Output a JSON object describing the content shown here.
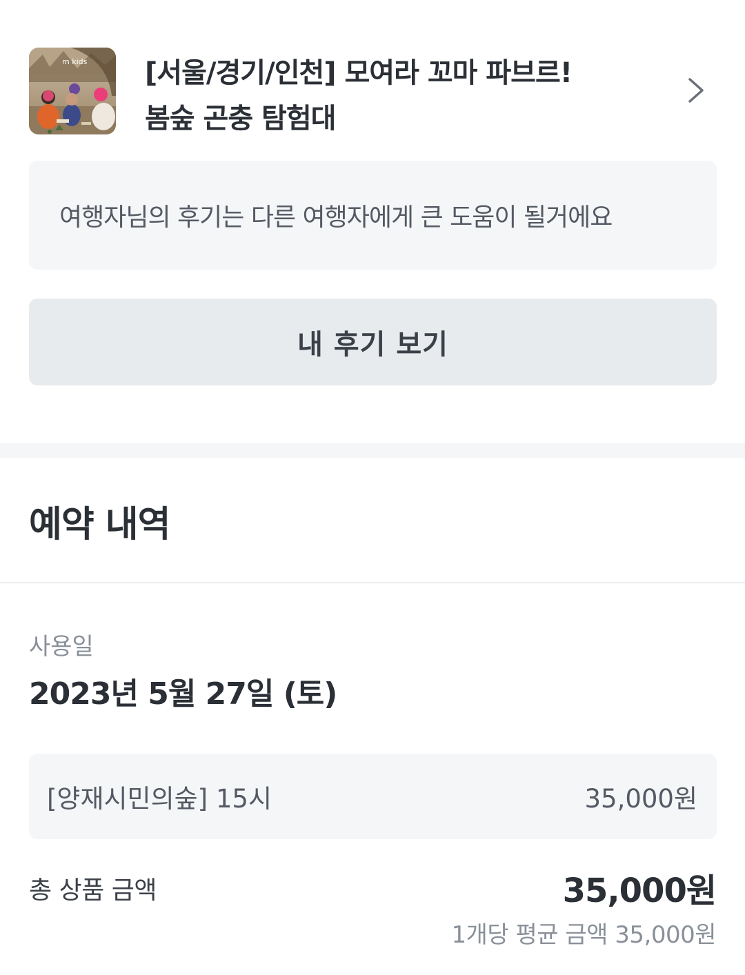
{
  "product": {
    "title_line1": "[서울/경기/인천] 모여라 꼬마 파브르!",
    "title_line2": "봄숲 곤충 탐험대",
    "thumbnail_caption": "m kids"
  },
  "review": {
    "hint": "여행자님의 후기는 다른 여행자에게 큰 도움이 될거에요",
    "my_review_button": "내 후기 보기"
  },
  "reservation": {
    "section_title": "예약 내역",
    "use_date_label": "사용일",
    "use_date_value": "2023년 5월 27일 (토)",
    "option_name": "[양재시민의숲] 15시",
    "option_price": "35,000원",
    "total_label": "총 상품 금액",
    "total_value": "35,000원",
    "average_label": "1개당 평균 금액 35,000원"
  },
  "colors": {
    "text_primary": "#2b2f36",
    "text_secondary": "#8a9099",
    "panel_bg": "#f5f6f8",
    "button_bg": "#e8ebee"
  }
}
